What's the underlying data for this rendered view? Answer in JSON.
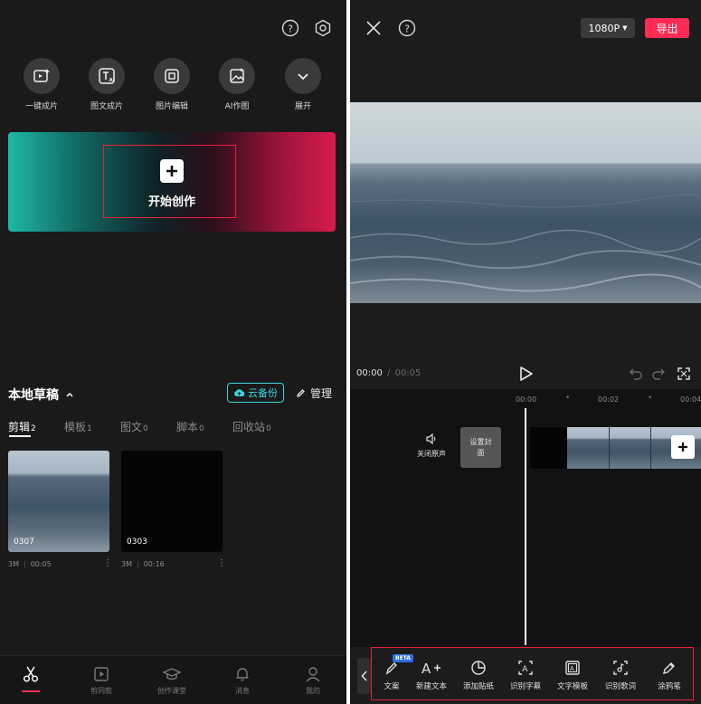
{
  "left": {
    "tools": [
      {
        "label": "一键成片",
        "icon": "magic-clip-icon"
      },
      {
        "label": "图文成片",
        "icon": "text-to-video-ai-icon"
      },
      {
        "label": "图片编辑",
        "icon": "image-edit-icon"
      },
      {
        "label": "AI作图",
        "icon": "ai-image-icon"
      },
      {
        "label": "展开",
        "icon": "chevron-down-icon"
      }
    ],
    "hero_label": "开始创作",
    "drafts_title": "本地草稿",
    "cloud_backup": "云备份",
    "manage": "管理",
    "tabs": [
      {
        "label": "剪辑",
        "count": "2"
      },
      {
        "label": "模板",
        "count": "1"
      },
      {
        "label": "图文",
        "count": "0"
      },
      {
        "label": "脚本",
        "count": "0"
      },
      {
        "label": "回收站",
        "count": "0"
      }
    ],
    "drafts": [
      {
        "name": "0307",
        "size": "3M",
        "duration": "00:05"
      },
      {
        "name": "0303",
        "size": "3M",
        "duration": "00:16"
      }
    ],
    "nav": [
      {
        "label": "",
        "icon": "scissors-icon"
      },
      {
        "label": "剪同款",
        "icon": "template-play-icon"
      },
      {
        "label": "创作课堂",
        "icon": "graduation-cap-icon"
      },
      {
        "label": "消息",
        "icon": "bell-icon"
      },
      {
        "label": "我的",
        "icon": "user-icon"
      }
    ]
  },
  "right": {
    "resolution": "1080P",
    "export": "导出",
    "time_current": "00:00",
    "time_separator": "/",
    "time_total": "00:05",
    "ruler": [
      "00:00",
      "00:02",
      "00:04"
    ],
    "mute_label": "关闭原声",
    "cover_label": "设置封面",
    "beta": "BETA",
    "toolbar": [
      {
        "label": "文案",
        "icon": "copywriting-pen-icon"
      },
      {
        "label": "新建文本",
        "icon": "add-text-icon"
      },
      {
        "label": "添加贴纸",
        "icon": "sticker-icon"
      },
      {
        "label": "识别字幕",
        "icon": "recognize-subtitle-icon"
      },
      {
        "label": "文字模板",
        "icon": "text-template-icon"
      },
      {
        "label": "识别歌词",
        "icon": "recognize-lyrics-icon"
      },
      {
        "label": "涂鸦笔",
        "icon": "brush-icon"
      }
    ],
    "colors": {
      "accent": "#fe2c55",
      "highlight_box": "#e8203b",
      "cloud": "#3bd5e0"
    }
  }
}
